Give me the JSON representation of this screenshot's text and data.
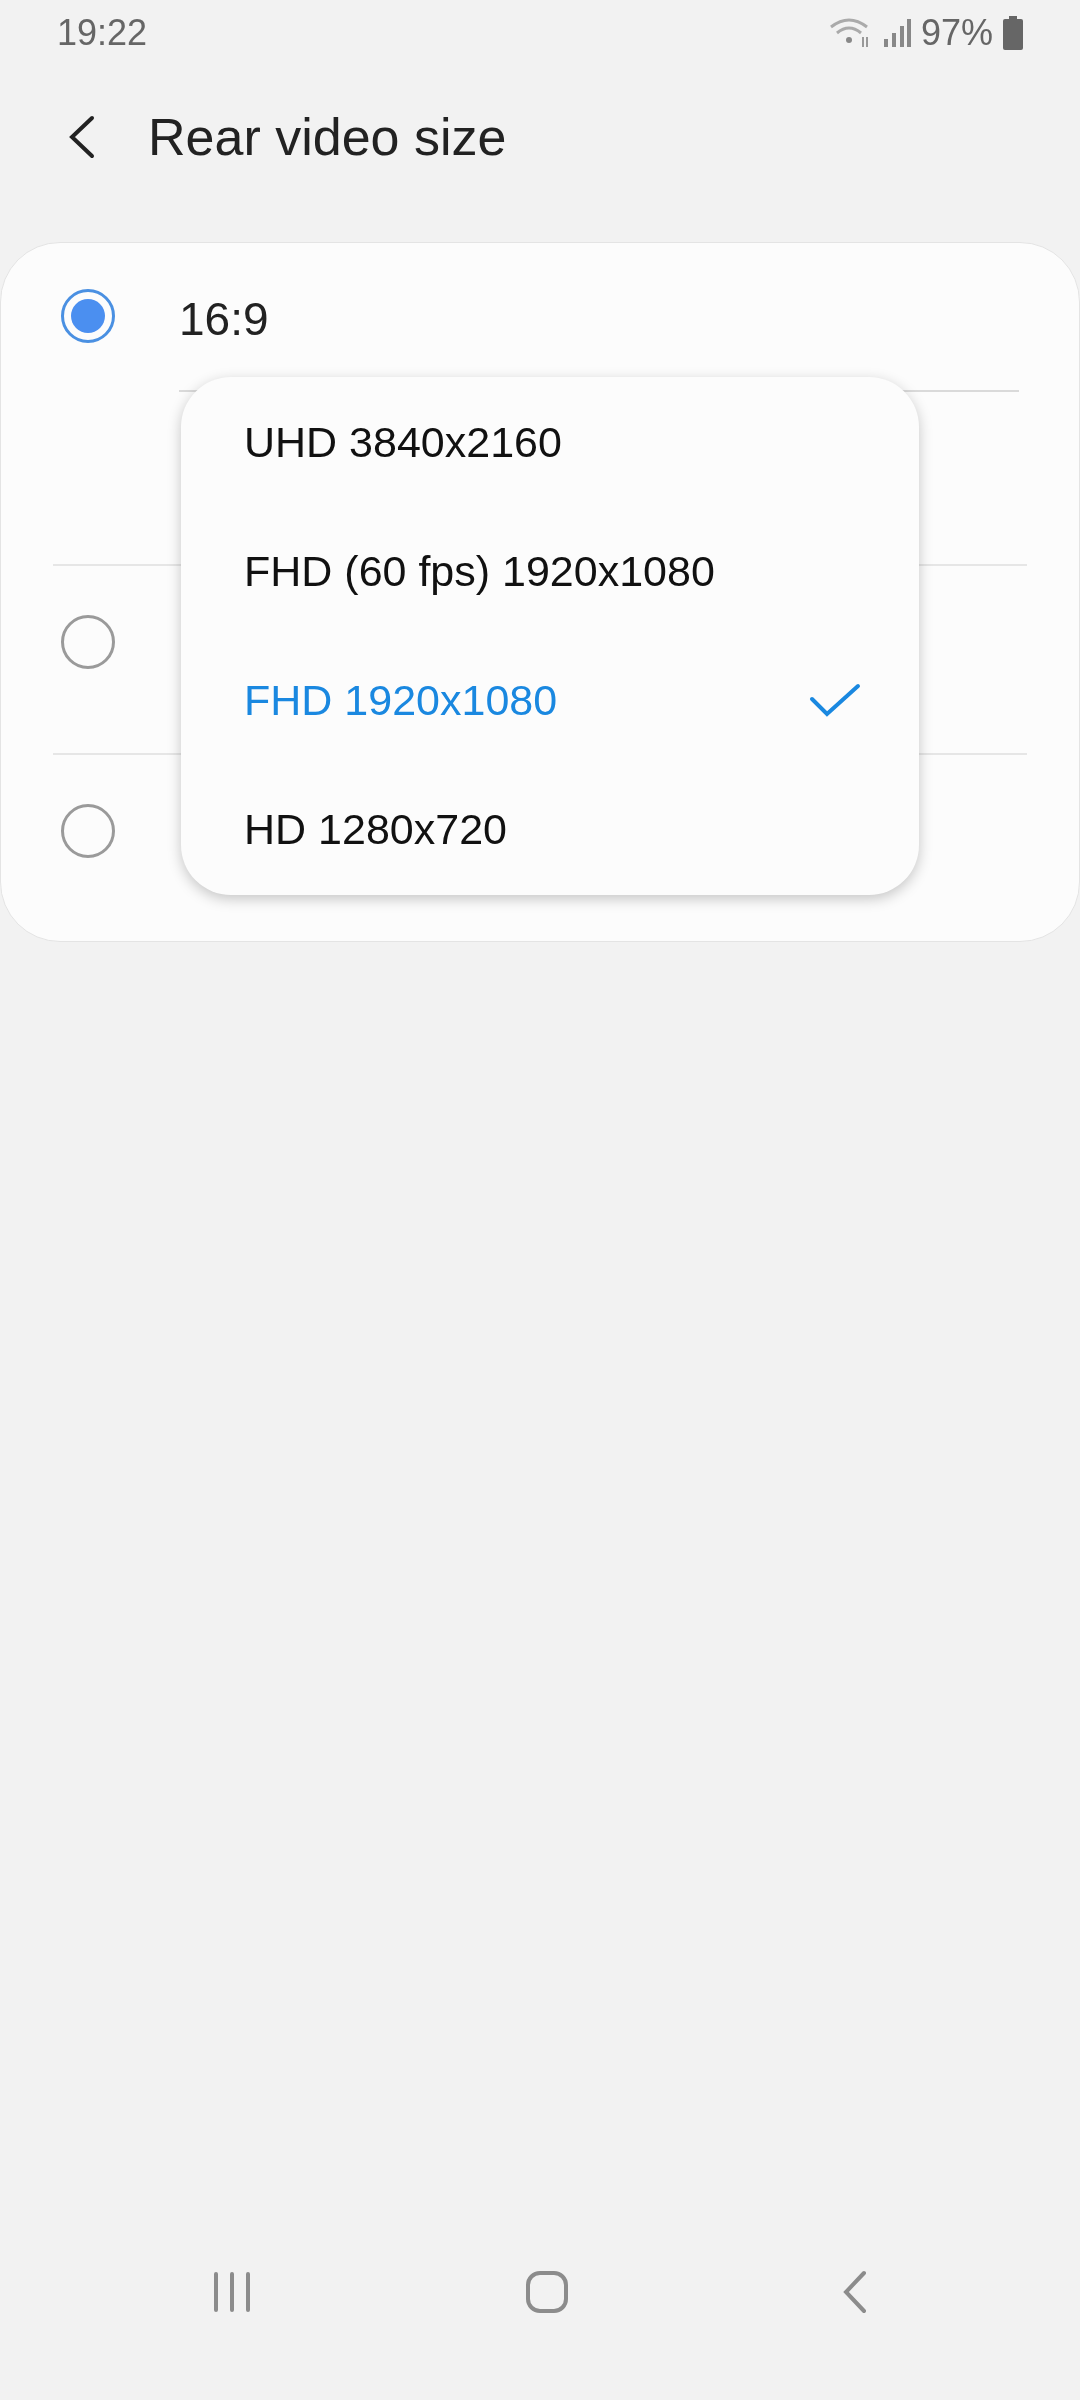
{
  "status_bar": {
    "time": "19:22",
    "battery": "97%"
  },
  "header": {
    "title": "Rear video size"
  },
  "options": [
    {
      "label": "16:9",
      "selected": true
    },
    {
      "selected": false
    },
    {
      "selected": false
    }
  ],
  "menu": {
    "items": [
      {
        "label": "UHD 3840x2160",
        "selected": false
      },
      {
        "label": "FHD (60 fps) 1920x1080",
        "selected": false
      },
      {
        "label": "FHD 1920x1080",
        "selected": true
      },
      {
        "label": "HD 1280x720",
        "selected": false
      }
    ]
  }
}
